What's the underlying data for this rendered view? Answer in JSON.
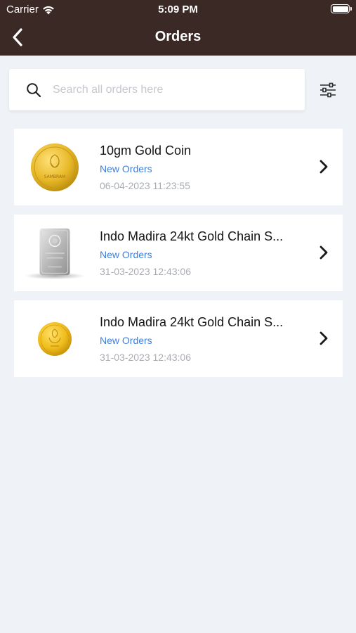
{
  "status_bar": {
    "carrier": "Carrier",
    "time": "5:09 PM"
  },
  "nav": {
    "title": "Orders",
    "back_icon": "chevron-left-icon"
  },
  "search": {
    "placeholder": "Search all orders here",
    "value": "",
    "icon": "search-icon",
    "filter_icon": "sliders-icon"
  },
  "orders": [
    {
      "title": "10gm Gold Coin",
      "status": "New Orders",
      "date": "06-04-2023 11:23:55",
      "thumb": "gold-coin-sambram",
      "thumb_text": "SAMBRAM"
    },
    {
      "title": "Indo Madira 24kt Gold Chain S...",
      "status": "New Orders",
      "date": "31-03-2023 12:43:06",
      "thumb": "silver-bar"
    },
    {
      "title": "Indo Madira 24kt Gold Chain S...",
      "status": "New Orders",
      "date": "31-03-2023 12:43:06",
      "thumb": "gold-coin-small"
    }
  ],
  "colors": {
    "header_bg": "#3a2924",
    "page_bg": "#eff3f7",
    "status_blue": "#3e7fd9",
    "date_gray": "#a9adb3"
  }
}
